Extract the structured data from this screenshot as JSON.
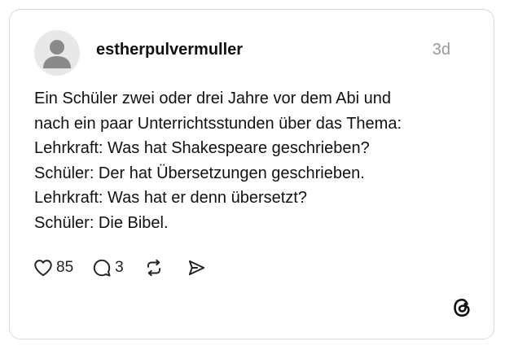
{
  "post": {
    "username": "estherpulvermuller",
    "timestamp": "3d",
    "lines": [
      "Ein Schüler zwei oder drei Jahre vor dem Abi und",
      "nach ein paar Unterrichtsstunden über das Thema:",
      "Lehrkraft: Was hat Shakespeare geschrieben?",
      "Schüler: Der hat Übersetzungen geschrieben.",
      "Lehrkraft: Was hat er denn übersetzt?",
      "Schüler: Die Bibel."
    ]
  },
  "actions": {
    "like_icon": "heart-icon",
    "like_count": "85",
    "reply_icon": "speech-bubble-icon",
    "reply_count": "3",
    "repost_icon": "repost-icon",
    "share_icon": "send-icon"
  },
  "branding": {
    "logo_icon": "threads-logo-icon"
  },
  "colors": {
    "text": "#111111",
    "timestamp": "#9a9a9a",
    "border": "#d9d9d9",
    "avatar_bg": "#e8e8e8",
    "avatar_fg": "#8a8a8a"
  }
}
